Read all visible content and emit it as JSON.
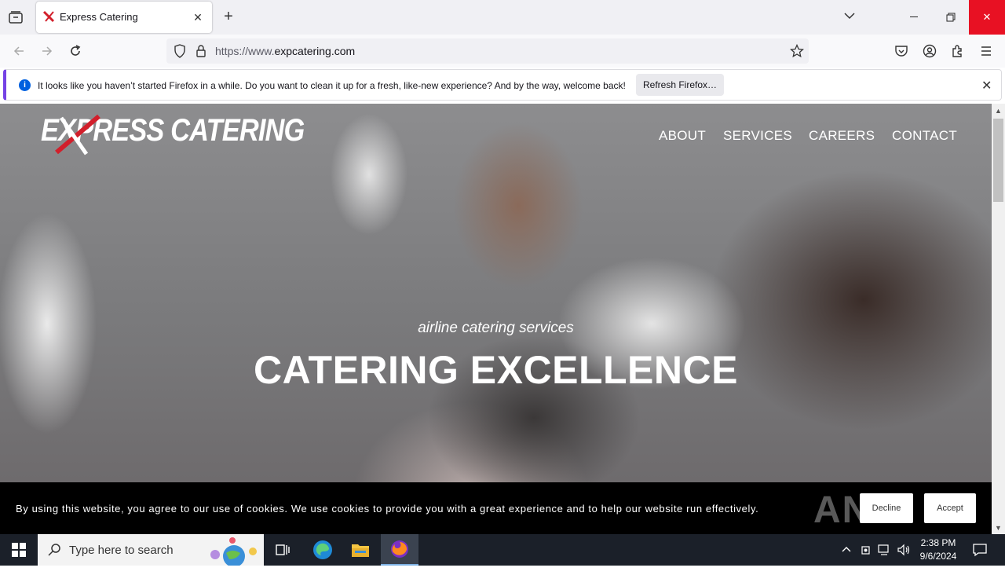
{
  "browser": {
    "tab": {
      "title": "Express Catering"
    },
    "url": {
      "prefix": "https://www.",
      "domain": "expcatering.com"
    },
    "notification": {
      "text": "It looks like you haven’t started Firefox in a while. Do you want to clean it up for a fresh, like-new experience? And by the way, welcome back!",
      "button": "Refresh Firefox…"
    }
  },
  "site": {
    "logo": "EXPRESS CATERING",
    "nav": [
      "ABOUT",
      "SERVICES",
      "CAREERS",
      "CONTACT"
    ],
    "hero": {
      "tagline": "airline catering services",
      "headline": "CATERING EXCELLENCE"
    },
    "cookie": {
      "text": "By using this website, you agree to our use of cookies. We use cookies to provide you with a great experience and to help our website run effectively.",
      "decline": "Decline",
      "accept": "Accept",
      "watermark": "ANY RUN"
    }
  },
  "taskbar": {
    "search_placeholder": "Type here to search",
    "time": "2:38 PM",
    "date": "9/6/2024"
  },
  "colors": {
    "accent_red": "#e81123",
    "firefox_blue": "#0060df"
  }
}
